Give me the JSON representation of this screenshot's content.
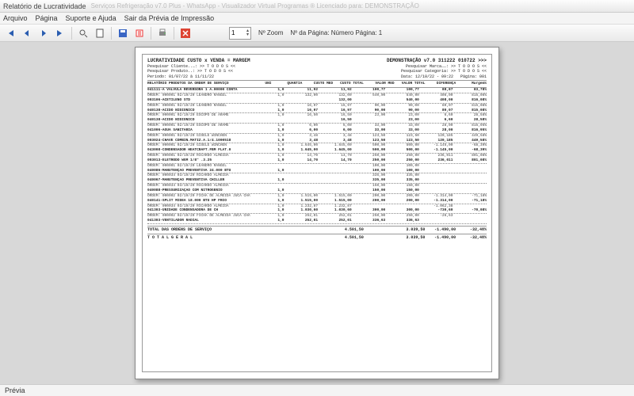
{
  "window": {
    "title": "Relatório de Lucratividade",
    "faded": "Serviços Refrigeração v7.0 Plus - WhatsApp - Visualizador Virtual Programas ® Licenciado para: DEMONSTRAÇÃO"
  },
  "menu": {
    "arquivo": "Arquivo",
    "pagina": "Página",
    "suporte": "Suporte e Ajuda",
    "sair": "Sair da Prévia de Impressão"
  },
  "toolbar": {
    "zoom_value": "1",
    "zoom_label": "Nº Zoom",
    "page_label": "Nº da Página: Número Página: 1"
  },
  "statusbar": {
    "text": "Prévia"
  },
  "report": {
    "title_left": "LUCRATIVIDADE  CUSTO x VENDA = MARGEM",
    "title_right": "DEMONSTRAÇÃO v7.0 311222 010722 >>>",
    "filt_cli": "Pesquisar Cliente..…: >>  T O D O S  <<",
    "filt_prod": "Pesquisar Produto..: >>  T O D O S  <<",
    "filt_marca": "Pesquisar Marca……: >>  T O D O S  <<",
    "filt_cat": "Pesquisar Categoria: >>  T O D O S  <<",
    "periodo": "Período: 01/07/22 à 11/11/22",
    "data": "Data: 12/10/22 - 09:22",
    "pagina": "Página:  001",
    "cols": [
      "RELATÓRIO PRODUTOS DA ORDEM DE SERVIÇO",
      "UNI",
      "QUANTIA",
      "CUSTO MED",
      "CUSTO TOTAL",
      "VALOR MED",
      "VALOR TOTAL",
      "DIFERENÇA",
      "Margem%"
    ],
    "rows": [
      {
        "t": "h",
        "c": [
          "041111-A VALVULA REVERSORA 1 A.00000 CONTA",
          "1,0",
          "11,92",
          "11,92",
          "100,77",
          "100,77",
          "88,87",
          "83,78%"
        ]
      },
      {
        "t": "s",
        "c": [
          "ORDEM: 000001 02/19/20  LEANDRO RANGEL",
          "1,0",
          "132,00",
          "132,00",
          "540,00",
          "540,00",
          "408,00",
          "816,08%"
        ]
      },
      {
        "t": "h",
        "c": [
          "003106-ACETILENO STD",
          "",
          "",
          "132,00",
          "",
          "540,00",
          "408,00",
          "816,08%"
        ]
      },
      {
        "t": "s",
        "c": [
          "ORDEM: 000001 02/19/20  LEANDRO RANGEL",
          "1,0",
          "16,97",
          "16,97",
          "90,00",
          "90,00",
          "80,07",
          "815,08%"
        ]
      },
      {
        "t": "h",
        "c": [
          "040138-ACIDO NIDIONICO",
          "1,0",
          "16,97",
          "16,97",
          "90,00",
          "90,00",
          "80,07",
          "815,08%"
        ]
      },
      {
        "t": "s",
        "c": [
          "ORDEM: 000001 02/19/20  ESCOPO DE ARAME",
          "1,0",
          "16,50",
          "16,50",
          "23,00",
          "23,00",
          "6,60",
          "28,58%"
        ]
      },
      {
        "t": "h",
        "c": [
          "040138-ACIDO NIDIONICO",
          "",
          "",
          "16,50",
          "",
          "23,00",
          "6,60",
          "28,58%"
        ]
      },
      {
        "t": "s",
        "c": [
          "ORDEM: 000001 02/19/20  ESCOPO DE ARAME",
          "1,0",
          "6,00",
          "6,00",
          "33,00",
          "33,00",
          "28,00",
          "816,95%"
        ]
      },
      {
        "t": "h",
        "c": [
          "041006-ÁGUA SANITÁRIA",
          "1,0",
          "6,00",
          "6,00",
          "33,00",
          "33,00",
          "28,00",
          "816,95%"
        ]
      },
      {
        "t": "s",
        "c": [
          "ORDEM: 000001 02/19/20  GISELE WINCHEN",
          "1,0",
          "3,48",
          "3,48",
          "123,50",
          "123,50",
          "120,185",
          "449,58%"
        ]
      },
      {
        "t": "h",
        "c": [
          "003024-CHAVE COMBIN.MATIZ.A.1/4.1000518",
          "1,0",
          "3,48",
          "3,48",
          "123,50",
          "123,50",
          "120,185",
          "449,58%"
        ]
      },
      {
        "t": "s",
        "c": [
          "ORDEM: 000001 02/19/20  GISELE WINCHEN",
          "1,0",
          "1.645,00",
          "1.645,00",
          "500,00",
          "500,00",
          "-1.145,00",
          "-68,39%"
        ]
      },
      {
        "t": "h",
        "c": [
          "043008-CONDENSADOR HEATCRAFT.FBM FLAT.0",
          "1,0",
          "1.645,00",
          "1.645,00",
          "500,00",
          "500,00",
          "-1.145,00",
          "-68,39%"
        ]
      },
      {
        "t": "s",
        "c": [
          "ORDEM: 000001 02/19/20  RICARDO ALMEIDA",
          "1,0",
          "14,70",
          "14,70",
          "250,00",
          "250,00",
          "236,011",
          "801,08%"
        ]
      },
      {
        "t": "h",
        "c": [
          "003013-ELETRODO WGM 1/8\" .3.25",
          "1,0",
          "14,70",
          "14,70",
          "250,00",
          "250,00",
          "236,011",
          "801,08%"
        ]
      },
      {
        "t": "s",
        "c": [
          "ORDEM: 000001 02/19/20  LEANDRO RANGEL",
          "",
          "",
          "",
          "100,00",
          "100,00",
          "",
          ""
        ]
      },
      {
        "t": "h",
        "c": [
          "040086-MANUTENÇÃO PREVENTIVA 24.000 BTU",
          "1,0",
          "",
          "",
          "100,00",
          "100,00",
          "",
          ""
        ]
      },
      {
        "t": "s",
        "c": [
          "ORDEM: 000034 03/19/20  RICARDO ALMEIDA",
          "",
          "",
          "",
          "335,00",
          "335,00",
          "",
          ""
        ]
      },
      {
        "t": "h",
        "c": [
          "040067-MANUTENÇÃO PREVENTIVA CHILLER",
          "1,0",
          "",
          "",
          "335,00",
          "335,00",
          "",
          ""
        ]
      },
      {
        "t": "s",
        "c": [
          "ORDEM: 000034 03/19/20  RICARDO ALMEIDA",
          "",
          "",
          "",
          "150,00",
          "150,00",
          "",
          ""
        ]
      },
      {
        "t": "h",
        "c": [
          "040088-PRESSURIZAÇÃO COM NITROGÊNIO",
          "1,0",
          "",
          "",
          "150,00",
          "150,00",
          "",
          ""
        ]
      },
      {
        "t": "s",
        "c": [
          "ORDEM: 000002 02/19/20  FICHA DE ALMEIDA JUCA CHAVES",
          "1,0",
          "1.515,00",
          "1.515,00",
          "200,00",
          "200,00",
          "-1.314,00",
          "-71,18%"
        ]
      },
      {
        "t": "h",
        "c": [
          "040141-SPLIT MIDEA 18.000 BTU HP FRIO",
          "1,0",
          "1.515,00",
          "1.515,00",
          "200,00",
          "200,00",
          "-1.314,00",
          "-71,18%"
        ]
      },
      {
        "t": "s",
        "c": [
          "ORDEM: 000034 03/19/20  RICARDO ALMEIDA",
          "1,0",
          "1.232,87",
          "1.232,87",
          "",
          "",
          "-1.062,38",
          "",
          ""
        ]
      },
      {
        "t": "h",
        "c": [
          "041303-UNIDADE CONDENSADORA DE CH",
          "1,0",
          "1.030,60",
          "1.030,60",
          "300,00",
          "300,00",
          "-730,60",
          "-70,08%"
        ]
      },
      {
        "t": "s",
        "c": [
          "ORDEM: 000002 02/19/20  FICHA DE ALMEIDA JUCA CHAVES",
          "1,0",
          "252,01",
          "252,01",
          "250,00",
          "250,00",
          "-26,63",
          "",
          ""
        ]
      },
      {
        "t": "h",
        "c": [
          "041303-VENTILADOR RADIAL",
          "1,0",
          "252,01",
          "252,01",
          "336,63",
          "336,63",
          "",
          "",
          ""
        ]
      }
    ],
    "total_os": [
      "TOTAL DAS ORDENS DE SERVIÇO",
      "",
      "",
      "",
      "4.501,50",
      "",
      "3.039,50",
      "-1.490,00",
      "-32,48%"
    ],
    "total_geral": [
      "T O T A L   G E R A L",
      "",
      "",
      "",
      "4.501,50",
      "",
      "3.039,50",
      "-1.490,00",
      "-32,48%"
    ]
  }
}
